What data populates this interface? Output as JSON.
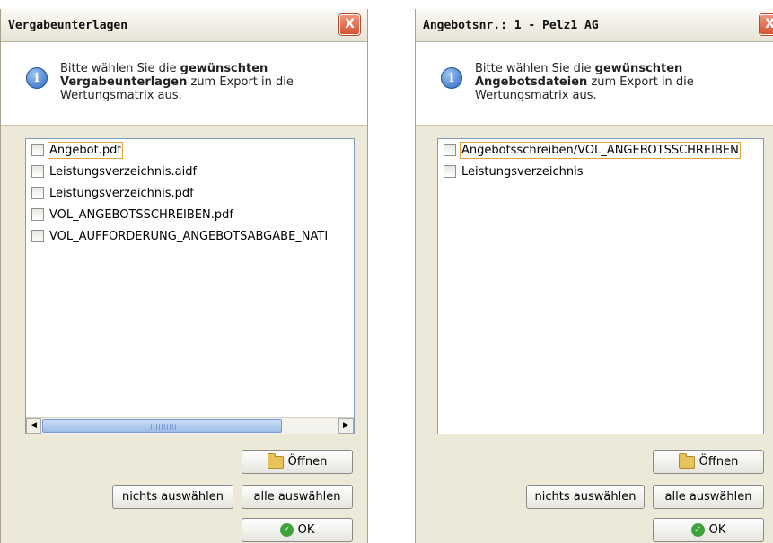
{
  "dialog1": {
    "title": "Vergabeunterlagen",
    "close": "X",
    "msg_pre": "Bitte wählen Sie die ",
    "msg_bold": "gewünschten Vergabeunterlagen",
    "msg_post": " zum Export in die Wertungsmatrix aus.",
    "items": [
      {
        "label": "Angebot.pdf",
        "checked": false
      },
      {
        "label": "Leistungsverzeichnis.aidf",
        "checked": false
      },
      {
        "label": "Leistungsverzeichnis.pdf",
        "checked": false
      },
      {
        "label": "VOL_ANGEBOTSSCHREIBEN.pdf",
        "checked": false
      },
      {
        "label": "VOL_AUFFORDERUNG_ANGEBOTSABGABE_NATI",
        "checked": false
      }
    ],
    "buttons": {
      "open": "Öffnen",
      "none": "nichts auswählen",
      "all": "alle auswählen",
      "ok": "OK"
    }
  },
  "dialog2": {
    "title": "Angebotsnr.: 1 - Pelz1 AG",
    "close": "X",
    "msg_pre": "Bitte wählen Sie die ",
    "msg_bold": "gewünschten Angebotsdateien",
    "msg_post": " zum Export in die Wertungsmatrix aus.",
    "items": [
      {
        "label": "Angebotsschreiben/VOL_ANGEBOTSSCHREIBEN",
        "checked": false
      },
      {
        "label": "Leistungsverzeichnis",
        "checked": false
      }
    ],
    "buttons": {
      "open": "Öffnen",
      "none": "nichts auswählen",
      "all": "alle auswählen",
      "ok": "OK"
    }
  },
  "icons": {
    "info": "information-icon",
    "open": "folder-open-icon",
    "ok": "checkmark-icon",
    "close": "close-icon"
  },
  "colors": {
    "dialog_bg": "#ece9d8",
    "listbox_border": "#7f9db9",
    "focus": "#e0a33a",
    "close_red": "#d3532f"
  }
}
